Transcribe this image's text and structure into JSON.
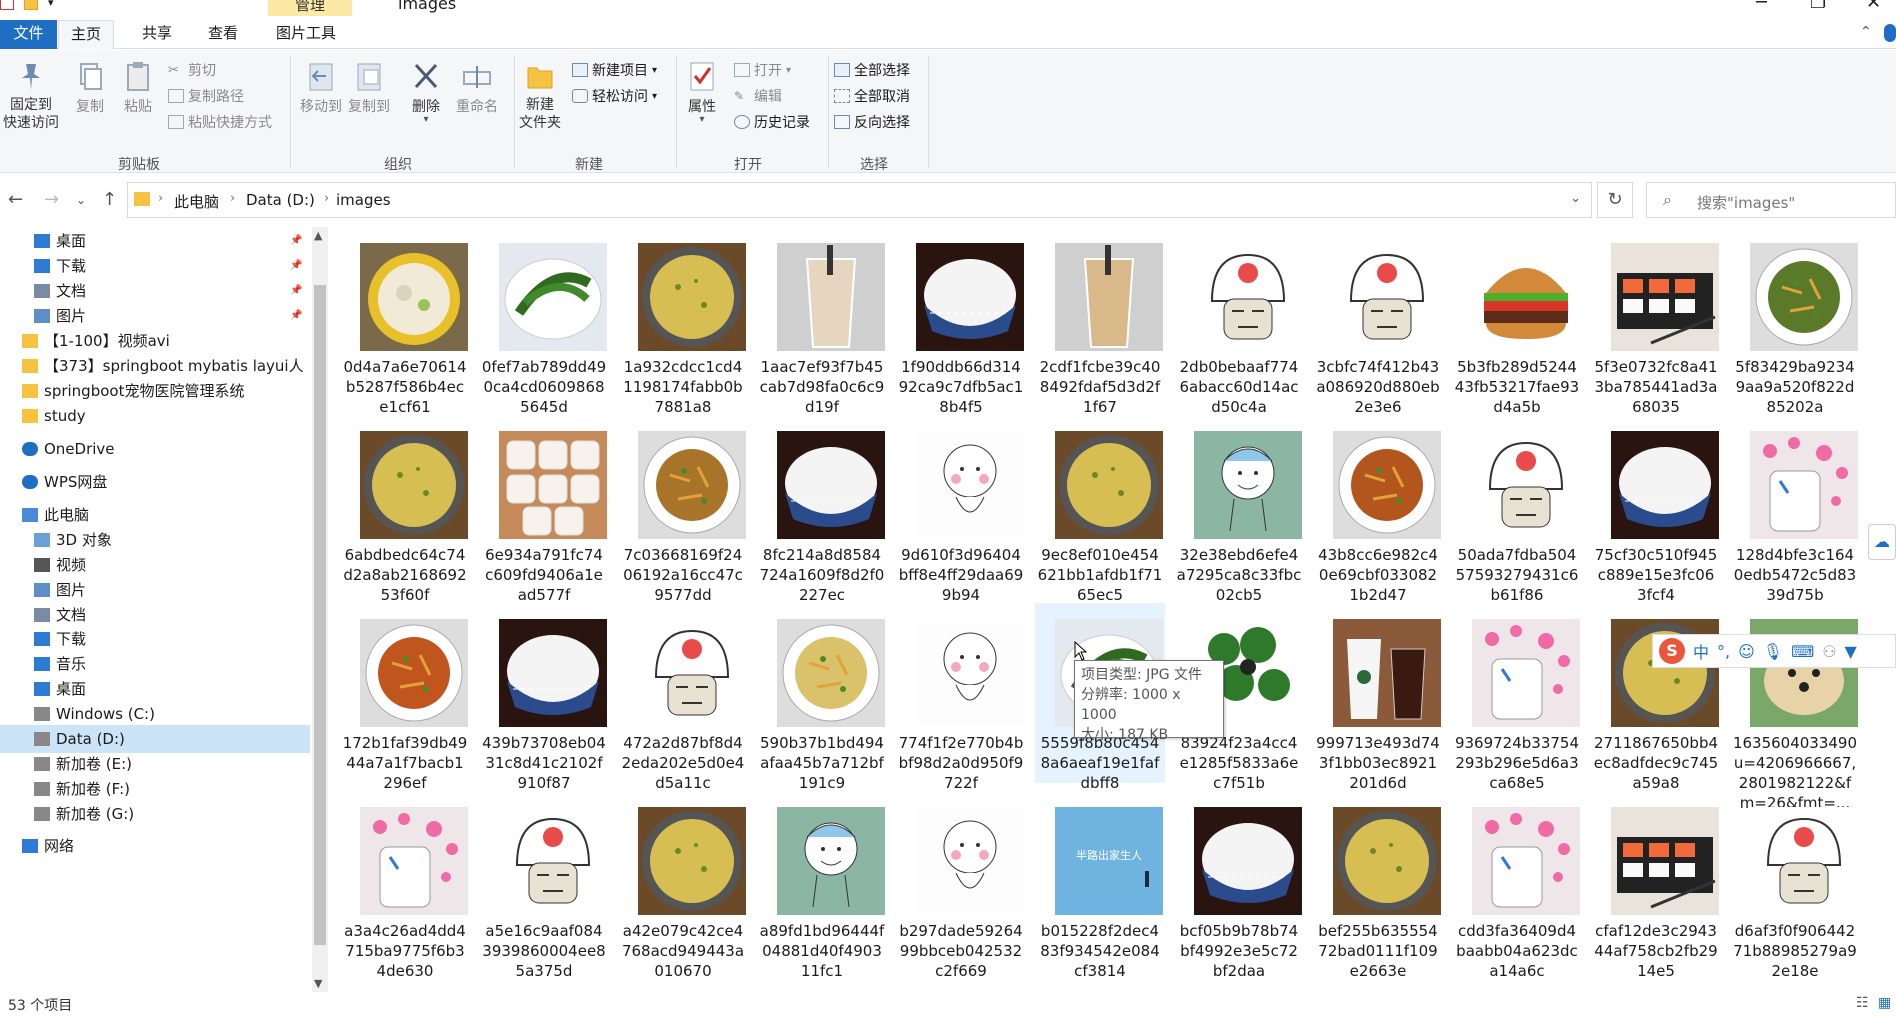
{
  "window": {
    "title": "images",
    "context_tab_label": "管理"
  },
  "ribbon_tabs": [
    {
      "label": "文件"
    },
    {
      "label": "主页"
    },
    {
      "label": "共享"
    },
    {
      "label": "查看"
    },
    {
      "label": "图片工具"
    }
  ],
  "ribbon": {
    "clipboard": {
      "pin_line1": "固定到",
      "pin_line2": "快速访问",
      "copy": "复制",
      "paste": "粘贴",
      "cut": "剪切",
      "copy_path": "复制路径",
      "paste_shortcut": "粘贴快捷方式",
      "group_label": "剪贴板"
    },
    "organize": {
      "move_to": "移动到",
      "copy_to": "复制到",
      "delete": "删除",
      "rename": "重命名",
      "group_label": "组织"
    },
    "new": {
      "new_folder_line1": "新建",
      "new_folder_line2": "文件夹",
      "new_item": "新建项目",
      "easy_access": "轻松访问",
      "group_label": "新建"
    },
    "open": {
      "properties": "属性",
      "open": "打开",
      "edit": "编辑",
      "history": "历史记录",
      "group_label": "打开"
    },
    "select": {
      "select_all": "全部选择",
      "select_none": "全部取消",
      "invert": "反向选择",
      "group_label": "选择"
    }
  },
  "address": {
    "crumbs": [
      "此电脑",
      "Data (D:)",
      "images"
    ],
    "search_placeholder": "搜索\"images\""
  },
  "sidebar": {
    "items": [
      {
        "label": "桌面",
        "icon": "desktop-icon",
        "pinned": true
      },
      {
        "label": "下载",
        "icon": "download-icon",
        "pinned": true
      },
      {
        "label": "文档",
        "icon": "document-icon",
        "pinned": true
      },
      {
        "label": "图片",
        "icon": "picture-icon",
        "pinned": true
      },
      {
        "label": "【1-100】视频avi",
        "icon": "folder-icon",
        "pinned": false
      },
      {
        "label": "【373】springboot mybatis layui人",
        "icon": "folder-icon",
        "pinned": false
      },
      {
        "label": "springboot宠物医院管理系统",
        "icon": "folder-icon",
        "pinned": false
      },
      {
        "label": "study",
        "icon": "folder-icon",
        "pinned": false
      },
      {
        "label": "OneDrive",
        "icon": "cloud-icon",
        "pinned": false
      },
      {
        "label": "WPS网盘",
        "icon": "cloud-icon",
        "pinned": false
      },
      {
        "label": "此电脑",
        "icon": "computer-icon",
        "pinned": false
      },
      {
        "label": "3D 对象",
        "icon": "cube-icon",
        "pinned": false
      },
      {
        "label": "视频",
        "icon": "video-icon",
        "pinned": false
      },
      {
        "label": "图片",
        "icon": "picture-icon",
        "pinned": false
      },
      {
        "label": "文档",
        "icon": "document-icon",
        "pinned": false
      },
      {
        "label": "下载",
        "icon": "download-icon",
        "pinned": false
      },
      {
        "label": "音乐",
        "icon": "music-icon",
        "pinned": false
      },
      {
        "label": "桌面",
        "icon": "desktop-icon",
        "pinned": false
      },
      {
        "label": "Windows (C:)",
        "icon": "drive-icon",
        "pinned": false
      },
      {
        "label": "Data (D:)",
        "icon": "drive-icon",
        "pinned": false,
        "selected": true
      },
      {
        "label": "新加卷 (E:)",
        "icon": "drive-icon",
        "pinned": false
      },
      {
        "label": "新加卷 (F:)",
        "icon": "drive-icon",
        "pinned": false
      },
      {
        "label": "新加卷 (G:)",
        "icon": "drive-icon",
        "pinned": false
      },
      {
        "label": "网络",
        "icon": "network-icon",
        "pinned": false
      }
    ]
  },
  "files": [
    {
      "name": "0d4a7a6e70614b5287f586b4ece1cf61",
      "kind": "soup",
      "color": "#e8c12a"
    },
    {
      "name": "0fef7ab789dd490ca4cd06098685645d",
      "kind": "greens",
      "color": "#3f7a2a"
    },
    {
      "name": "1a932cdcc1cd41198174fabb0b7881a8",
      "kind": "omelette",
      "color": "#c9b14a"
    },
    {
      "name": "1aac7ef93f7b45cab7d98fa0c6c9d19f",
      "kind": "milktea",
      "color": "#e6d6bf"
    },
    {
      "name": "1f90ddb66d31492ca9c7dfb5ac18b4f5",
      "kind": "rice",
      "color": "#f3f3f3"
    },
    {
      "name": "2cdf1fcbe39c408492fdaf5d3d2f1f67",
      "kind": "milktea",
      "color": "#d9b98a"
    },
    {
      "name": "2db0bebaaf7746abacc60d14acd50c4a",
      "kind": "meme",
      "color": "#ffffff"
    },
    {
      "name": "3cbfc74f412b43a086920d880eb2e3e6",
      "kind": "meme",
      "color": "#ffffff"
    },
    {
      "name": "5b3fb289d524443fb53217fae93d4a5b",
      "kind": "burger",
      "color": "#b5672b"
    },
    {
      "name": "5f3e0732fc8a413ba785441ad3a68035",
      "kind": "sushi",
      "color": "#e58a4a"
    },
    {
      "name": "5f83429ba92349aa9a520f822d85202a",
      "kind": "stirfry",
      "color": "#5a7a2a"
    },
    {
      "name": "6abdbedc64c74d2a8ab216869253f60f",
      "kind": "omelette",
      "color": "#c9b14a"
    },
    {
      "name": "6e934a791fc74c609fd9406a1ead577f",
      "kind": "buns",
      "color": "#f1ebe3"
    },
    {
      "name": "7c03668169f2406192a16cc47c9577dd",
      "kind": "chicken",
      "color": "#a8742a"
    },
    {
      "name": "8fc214a8d8584724a1609f8d2f0227ec",
      "kind": "rice",
      "color": "#f3f3f3"
    },
    {
      "name": "9d610f3d96404bff8e4ff29daa699b94",
      "kind": "cartoon",
      "color": "#fdfdfd"
    },
    {
      "name": "9ec8ef010e454621bb1afdb1f7165ec5",
      "kind": "omelette",
      "color": "#c9b14a"
    },
    {
      "name": "32e38ebd6efe4a7295ca8c33fbc02cb5",
      "kind": "doodle",
      "color": "#7fb09a"
    },
    {
      "name": "43b8cc6e982c40e69cbf0330821b2d47",
      "kind": "noodles",
      "color": "#b3561e"
    },
    {
      "name": "50ada7fdba50457593279431c6b61f86",
      "kind": "meme",
      "color": "#ffffff"
    },
    {
      "name": "75cf30c510f945c889e15e3fc063fcf4",
      "kind": "rice",
      "color": "#f3f3f3"
    },
    {
      "name": "128d4bfe3c1640edb5472c5d8339d75b",
      "kind": "hearts",
      "color": "#f3a9c7"
    },
    {
      "name": "172b1faf39db4944a7a1f7bacb1296ef",
      "kind": "noodles",
      "color": "#c0551e"
    },
    {
      "name": "439b73708eb0431c8d41c2102f910f87",
      "kind": "rice",
      "color": "#f3f3f3"
    },
    {
      "name": "472a2d87bf8d42eda202e5d0e4d5a11c",
      "kind": "meme",
      "color": "#ffffff"
    },
    {
      "name": "590b37b1bd494afaa45b7a712bf191c9",
      "kind": "friedrice",
      "color": "#d9c26a"
    },
    {
      "name": "774f1f2e770b4bbf98d2a0d950f9722f",
      "kind": "cartoon",
      "color": "#fdfdfd"
    },
    {
      "name": "5559f8b80c4548a6aeaf19e1fafdbff8",
      "kind": "greens",
      "color": "#3f7a2a"
    },
    {
      "name": "83924f23a4cc4e1285f5833a6ec7f51b",
      "kind": "broccoli",
      "color": "#2f7a2a"
    },
    {
      "name": "999713e493d743f1bb03ec8921201d6d",
      "kind": "coffee",
      "color": "#7a4a2a"
    },
    {
      "name": "9369724b33754293b296e5d6a3ca68e5",
      "kind": "hearts",
      "color": "#f3a9c7"
    },
    {
      "name": "2711867650bb4ec8adfdec9c745a59a8",
      "kind": "omelette",
      "color": "#c9b14a"
    },
    {
      "name": "1635604033490u=4206966667,2801982122&fm=26&fmt=...",
      "kind": "dog",
      "color": "#c79a5a"
    },
    {
      "name": "a3a4c26ad4dd4715ba9775f6b34de630",
      "kind": "hearts",
      "color": "#f3a9c7"
    },
    {
      "name": "a5e16c9aaf0843939860004ee85a375d",
      "kind": "meme",
      "color": "#ffffff"
    },
    {
      "name": "a42e079c42ce4768acd949443a010670",
      "kind": "omelette",
      "color": "#c9b14a"
    },
    {
      "name": "a89fd1bd96444f04881d40f490311fc1",
      "kind": "doodle",
      "color": "#7fb09a"
    },
    {
      "name": "b297dade5926499bbceb042532c2f669",
      "kind": "cartoon",
      "color": "#fdfdfd"
    },
    {
      "name": "b015228f2dec483f934542e084cf3814",
      "kind": "blue",
      "color": "#6fb3e0"
    },
    {
      "name": "bcf05b9b78b74bf4992e3e5c72bf2daa",
      "kind": "rice",
      "color": "#f3f3f3"
    },
    {
      "name": "bef255b63555472bad0111f109e2663e",
      "kind": "omelette",
      "color": "#c9b14a"
    },
    {
      "name": "cdd3fa36409d4baabb04a623dca14a6c",
      "kind": "hearts",
      "color": "#f3a9c7"
    },
    {
      "name": "cfaf12de3c294344af758cb2fb2914e5",
      "kind": "sushi",
      "color": "#e58a4a"
    },
    {
      "name": "d6af3f0f90644271b88985279a92e18e",
      "kind": "meme",
      "color": "#ffffff"
    }
  ],
  "hovered_file_index": 27,
  "tooltip": {
    "type": "项目类型: JPG 文件",
    "resolution": "分辨率: 1000 x 1000",
    "size": "大小: 187 KB"
  },
  "blue_image_text": "半路出家生人",
  "status": {
    "count": "53 个项目"
  },
  "ime": {
    "logo": "S",
    "lang": "中"
  },
  "colors": {
    "accent": "#1e6fc4",
    "selected_bg": "#cce4f7",
    "context_tab": "#fce9a6"
  }
}
